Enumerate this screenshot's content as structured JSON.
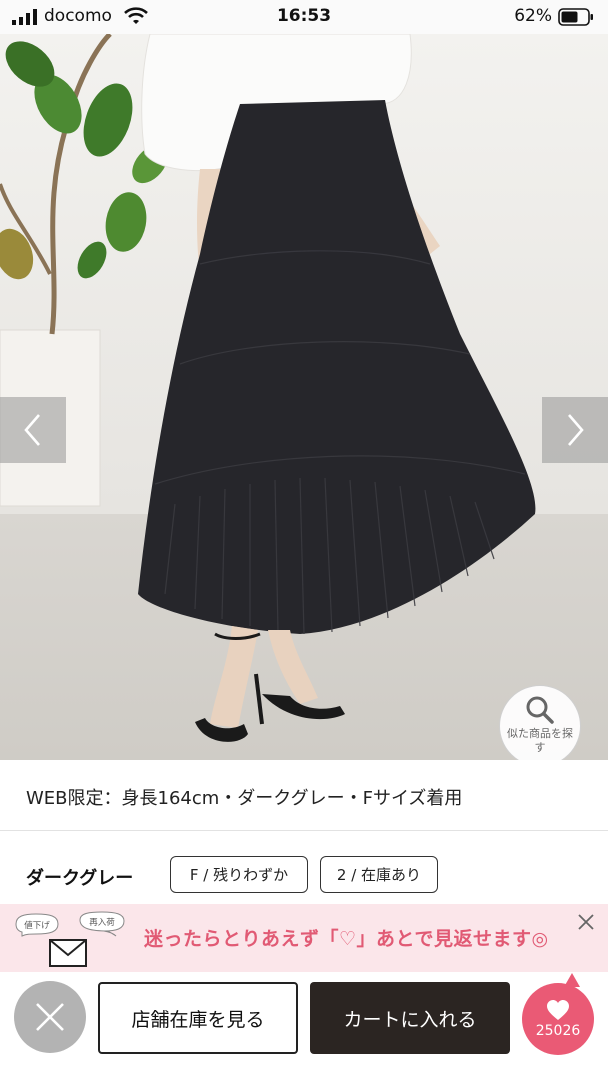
{
  "status_bar": {
    "carrier": "docomo",
    "time": "16:53",
    "battery_percent": "62%"
  },
  "product_image": {
    "prev_icon": "chevron-left-icon",
    "next_icon": "chevron-right-icon",
    "similar_search_label": "似た商品を探す",
    "similar_search_icon": "search-icon"
  },
  "caption": "WEB限定：身長164cm・ダークグレー・Fサイズ着用",
  "variants": {
    "color_name": "ダークグレー",
    "sizes": [
      {
        "label": "F / 残りわずか"
      },
      {
        "label": "2 / 在庫あり"
      }
    ]
  },
  "promo_banner": {
    "text": "迷ったらとりあえず「♡」あとで見返せます◎",
    "icon": "mail-icon",
    "bubble_left": "値下げ",
    "bubble_right": "再入荷",
    "close_icon": "close-icon"
  },
  "bottom_bar": {
    "close_icon": "close-icon",
    "store_stock_label": "店舗在庫を見る",
    "add_to_cart_label": "カートに入れる",
    "favorite_icon": "heart-icon",
    "favorite_count": "25026"
  },
  "colors": {
    "accent_pink": "#ea5a75",
    "banner_bg": "#fbe6ea",
    "cart_button": "#2b2522"
  }
}
